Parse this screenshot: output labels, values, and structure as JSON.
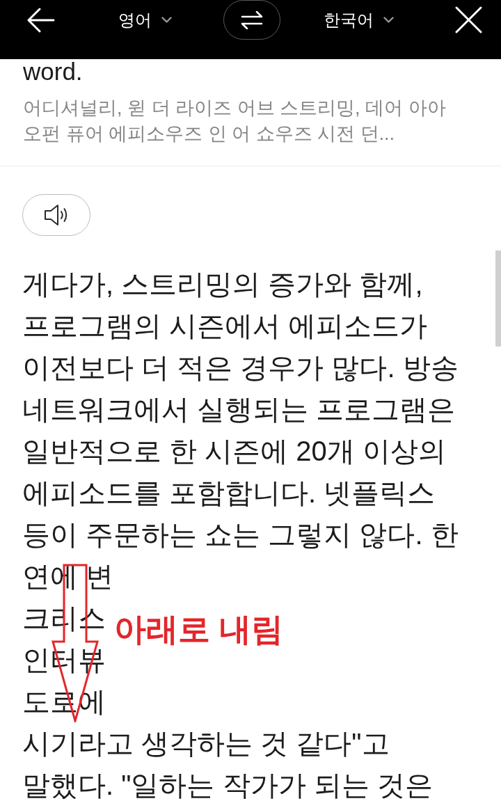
{
  "header": {
    "source_language": "영어",
    "target_language": "한국어"
  },
  "source": {
    "text": "word.",
    "pronunciation": "어디셔널리, 윋 더 라이즈 어브 스트리밍, 데어 아아 오펀 퓨어 에피소우즈 인 어 쇼우즈 시전 던..."
  },
  "translation": {
    "lines": [
      "게다가, 스트리밍의 증가와 함께,",
      "프로그램의 시즌에서 에피소드가",
      "이전보다 더 적은 경우가 많다. 방송",
      "네트워크에서 실행되는 프로그램은",
      "일반적으로 한 시즌에 20개 이상의",
      "에피소드를 포함합니다. 넷플릭스",
      "등이 주문하는 쇼는 그렇지 않다. 한",
      "연에 변",
      "크리스",
      "인터뷰",
      "도로에",
      "시기라고 생각하는 것 같다\"고",
      "말했다. \"일하는 작가가 되는 것은"
    ]
  },
  "annotation": {
    "label": "아래로 내림"
  }
}
